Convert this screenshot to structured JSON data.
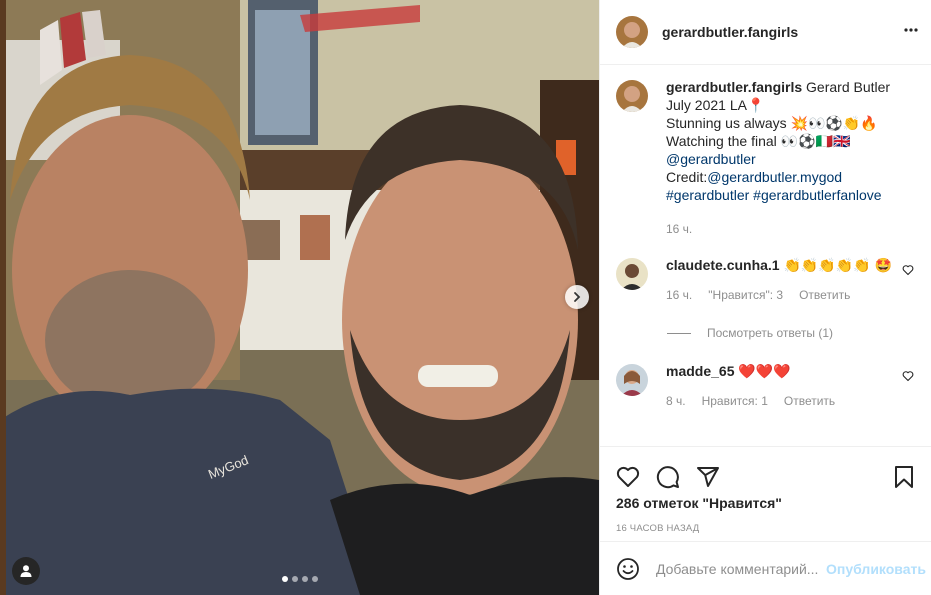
{
  "post": {
    "author": "gerardbutler.fangirls",
    "more_icon": "more-horizontal-icon"
  },
  "photo": {
    "shirt_text": "MyGod",
    "carousel_count": 4,
    "carousel_active": 1
  },
  "caption": {
    "username": "gerardbutler.fangirls",
    "line1": "Gerard Butler July 2021 LA📍",
    "line2": "Stunning us always 💥👀⚽👏🔥",
    "line3": "Watching the final 👀⚽🇮🇹🇬🇧",
    "mention": "@gerardbutler",
    "credit_label": "Credit:",
    "credit_handle": "@gerardbutler.mygod",
    "hashtag1": "#gerardbutler",
    "hashtag2": "#gerardbutlerfanlove",
    "time": "16 ч."
  },
  "comments": [
    {
      "username": "claudete.cunha.1",
      "text": "👏👏👏👏👏 🤩",
      "time": "16 ч.",
      "likes": "\"Нравится\": 3",
      "reply": "Ответить",
      "view_replies": "Посмотреть ответы (1)"
    },
    {
      "username": "madde_65",
      "text": "❤️❤️❤️",
      "time": "8 ч.",
      "likes": "Нравится: 1",
      "reply": "Ответить"
    }
  ],
  "likes_count": "286 отметок \"Нравится\"",
  "time_ago": "16 часов назад",
  "add_comment": {
    "placeholder": "Добавьте комментарий...",
    "post_label": "Опубликовать"
  },
  "colors": {
    "text": "#262626",
    "link": "#00376b",
    "muted": "#8e8e8e",
    "post_disabled": "#b2dffc"
  }
}
